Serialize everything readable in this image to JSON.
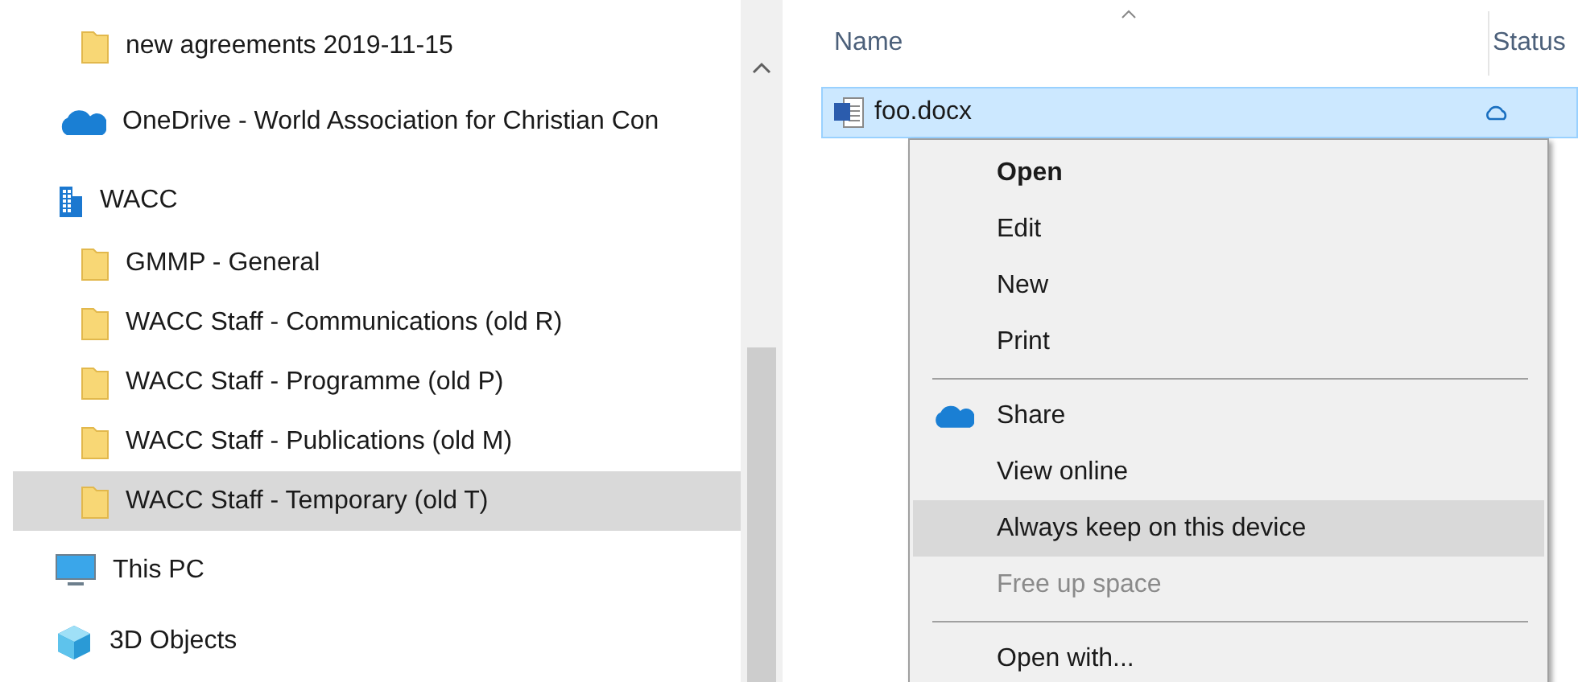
{
  "sidebar": {
    "items": [
      {
        "kind": "folder",
        "label": "new agreements 2019-11-15",
        "selected": false
      },
      {
        "kind": "cloud",
        "label": "OneDrive - World Association for Christian Con",
        "selected": false
      },
      {
        "kind": "building",
        "label": "WACC",
        "selected": false,
        "children": [
          {
            "kind": "folder",
            "label": "GMMP - General",
            "selected": false
          },
          {
            "kind": "folder",
            "label": "WACC Staff - Communications (old R)",
            "selected": false
          },
          {
            "kind": "folder",
            "label": "WACC Staff - Programme (old P)",
            "selected": false
          },
          {
            "kind": "folder",
            "label": "WACC Staff - Publications (old M)",
            "selected": false
          },
          {
            "kind": "folder",
            "label": "WACC Staff - Temporary (old T)",
            "selected": true
          }
        ]
      },
      {
        "kind": "pc",
        "label": "This PC",
        "selected": false
      },
      {
        "kind": "cube",
        "label": "3D Objects",
        "selected": false
      }
    ]
  },
  "file_list": {
    "columns": [
      "Name",
      "Status"
    ],
    "rows": [
      {
        "name": "foo.docx",
        "selected": true
      }
    ]
  },
  "context_menu": {
    "items": [
      {
        "kind": "item",
        "label": "Open",
        "default": true,
        "disabled": false,
        "selected": false,
        "icon": false
      },
      {
        "kind": "item",
        "label": "Edit",
        "default": false,
        "disabled": false,
        "selected": false,
        "icon": false
      },
      {
        "kind": "item",
        "label": "New",
        "default": false,
        "disabled": false,
        "selected": false,
        "icon": false
      },
      {
        "kind": "item",
        "label": "Print",
        "default": false,
        "disabled": false,
        "selected": false,
        "icon": false
      },
      {
        "kind": "separator"
      },
      {
        "kind": "item",
        "label": "Share",
        "default": false,
        "disabled": false,
        "selected": false,
        "icon": true
      },
      {
        "kind": "item",
        "label": "View online",
        "default": false,
        "disabled": false,
        "selected": false,
        "icon": false
      },
      {
        "kind": "item",
        "label": "Always keep on this device",
        "default": false,
        "disabled": false,
        "selected": true,
        "icon": false
      },
      {
        "kind": "item",
        "label": "Free up space",
        "default": false,
        "disabled": true,
        "selected": false,
        "icon": false
      },
      {
        "kind": "separator"
      },
      {
        "kind": "item",
        "label": "Open with...",
        "default": false,
        "disabled": false,
        "selected": false,
        "icon": false
      }
    ]
  }
}
